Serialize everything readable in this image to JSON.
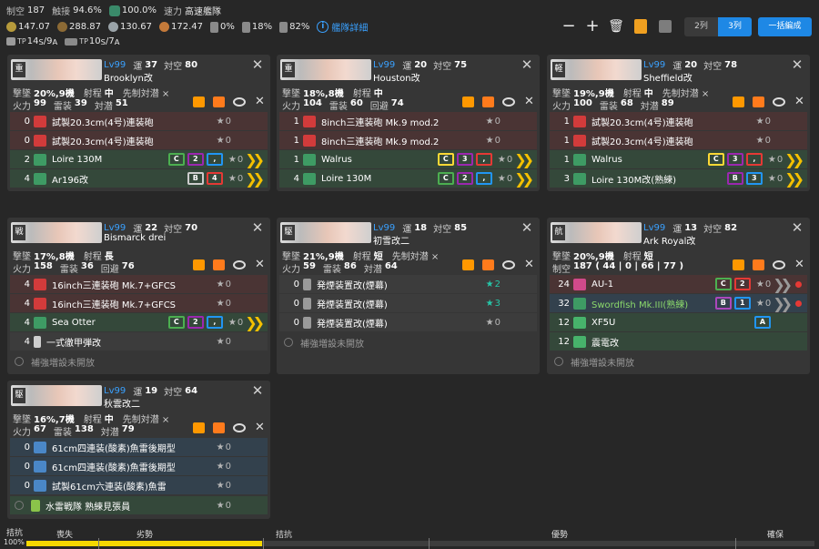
{
  "header": {
    "air_label": "制空",
    "air": "187",
    "contact_label": "触接",
    "contact": "94.6%",
    "speed_pct": "100.0%",
    "speed_label": "速力",
    "speed": "高速艦隊",
    "fuel": "147.07",
    "ammo": "288.87",
    "steel": "130.67",
    "baux": "172.47",
    "ration": "0%",
    "r1": "18%",
    "r2": "82%",
    "detail": "艦隊詳細",
    "tp_s_val": "14",
    "tp_s_sub": "S",
    "tp_a_val": "9",
    "tp_a_sub": "A",
    "tp2_s_val": "10",
    "tp2_s_sub": "S",
    "tp2_a_val": "7",
    "tp2_a_sub": "A",
    "col2": "2列",
    "col3": "3列",
    "bulk": "一括編成"
  },
  "labels": {
    "lv": "Lv99",
    "luck": "運",
    "aa": "対空",
    "fp": "火力",
    "torp": "雷装",
    "eva": "回避",
    "asw": "対潜",
    "range": "射程",
    "oasw": "先制対潜 ×",
    "ex": "補強増設未開放",
    "airpow": "制空"
  },
  "ships": [
    {
      "type": "重",
      "luck": "37",
      "aa": "80",
      "name": "Brooklyn改",
      "shot": "20%,9機",
      "range": "中",
      "oasw": "先制対潜 ×",
      "stats": [
        [
          "火力",
          "99"
        ],
        [
          "雷装",
          "39"
        ],
        [
          "対潜",
          "51"
        ]
      ],
      "slots": [
        [
          "0",
          "gun",
          "試製20.3cm(4号)連装砲",
          "0",
          "",
          ""
        ],
        [
          "0",
          "gun",
          "試製20.3cm(4号)連装砲",
          "0",
          "",
          ""
        ],
        [
          "2",
          "sea",
          "Loire 130M",
          "0",
          "C2,B3,A1",
          "y"
        ],
        [
          "4",
          "sea",
          "Ar196改",
          "0",
          "B4,A2",
          "y"
        ]
      ]
    },
    {
      "type": "重",
      "luck": "20",
      "aa": "75",
      "name": "Houston改",
      "shot": "18%,8機",
      "range": "中",
      "oasw": "",
      "stats": [
        [
          "火力",
          "104"
        ],
        [
          "雷装",
          "60"
        ],
        [
          "回避",
          "74"
        ]
      ],
      "slots": [
        [
          "1",
          "gun",
          "8inch三連装砲 Mk.9 mod.2",
          "0",
          "",
          ""
        ],
        [
          "1",
          "gun",
          "8inch三連装砲 Mk.9 mod.2",
          "0",
          "",
          ""
        ],
        [
          "1",
          "sea",
          "Walrus",
          "0",
          "C3,B2,A2",
          "y"
        ],
        [
          "4",
          "sea",
          "Loire 130M",
          "0",
          "C2,B3,A1",
          "y"
        ]
      ]
    },
    {
      "type": "軽",
      "luck": "20",
      "aa": "78",
      "name": "Sheffield改",
      "shot": "19%,9機",
      "range": "中",
      "oasw": "先制対潜 ×",
      "stats": [
        [
          "火力",
          "100"
        ],
        [
          "雷装",
          "68"
        ],
        [
          "対潜",
          "89"
        ]
      ],
      "slots": [
        [
          "1",
          "gun",
          "試製20.3cm(4号)連装砲",
          "0",
          "",
          ""
        ],
        [
          "1",
          "gun",
          "試製20.3cm(4号)連装砲",
          "0",
          "",
          ""
        ],
        [
          "1",
          "sea",
          "Walrus",
          "0",
          "C3,B2,A2",
          "y"
        ],
        [
          "3",
          "sea",
          "Loire 130M改(熟練)",
          "0",
          "B3,A1",
          "y"
        ]
      ]
    },
    {
      "type": "戦",
      "luck": "22",
      "aa": "70",
      "name": "Bismarck drei",
      "shot": "17%,8機",
      "range": "長",
      "oasw": "",
      "stats": [
        [
          "火力",
          "158"
        ],
        [
          "雷装",
          "36"
        ],
        [
          "回避",
          "76"
        ]
      ],
      "slots": [
        [
          "4",
          "gun",
          "16inch三連装砲 Mk.7+GFCS",
          "0",
          "",
          ""
        ],
        [
          "4",
          "gun",
          "16inch三連装砲 Mk.7+GFCS",
          "0",
          "",
          ""
        ],
        [
          "4",
          "sea",
          "Sea Otter",
          "0",
          "C2,B2,A1",
          "y"
        ],
        [
          "4",
          "shell",
          "一式徹甲弾改",
          "0",
          "",
          ""
        ]
      ]
    },
    {
      "type": "駆",
      "luck": "18",
      "aa": "85",
      "name": "初雪改二",
      "shot": "21%,9機",
      "range": "短",
      "oasw": "先制対潜 ×",
      "stats": [
        [
          "火力",
          "59"
        ],
        [
          "雷装",
          "86"
        ],
        [
          "対潜",
          "64"
        ]
      ],
      "slots": [
        [
          "0",
          "smoke",
          "発煙装置改(煙幕)",
          "2",
          "",
          "c"
        ],
        [
          "0",
          "smoke",
          "発煙装置改(煙幕)",
          "3",
          "",
          "c"
        ],
        [
          "0",
          "smoke",
          "発煙装置改(煙幕)",
          "0",
          "",
          ""
        ]
      ]
    },
    {
      "type": "航",
      "luck": "13",
      "aa": "82",
      "name": "Ark Royal改",
      "shot": "20%,9機",
      "range": "短",
      "oasw": "",
      "stats": [
        [
          "制空",
          "187 ( 44 | 0 | 66 | 77 )"
        ]
      ],
      "slots": [
        [
          "24",
          "aa",
          "AU-1",
          "0",
          "C2,A2",
          "gr"
        ],
        [
          "32",
          "tb",
          "Swordfish Mk.III(熟練)",
          "0",
          "B1,A1",
          "gr"
        ],
        [
          "12",
          "fighter",
          "XF5U",
          "",
          "A3",
          ""
        ],
        [
          "12",
          "fighter",
          "震電改",
          "",
          "",
          ""
        ]
      ]
    },
    {
      "type": "駆",
      "luck": "19",
      "aa": "64",
      "name": "秋雲改二",
      "shot": "16%,7機",
      "range": "中",
      "oasw": "先制対潜 ×",
      "stats": [
        [
          "火力",
          "67"
        ],
        [
          "雷装",
          "138"
        ],
        [
          "対潜",
          "79"
        ]
      ],
      "slots": [
        [
          "0",
          "torp",
          "61cm四連装(酸素)魚雷後期型",
          "0",
          "",
          ""
        ],
        [
          "0",
          "torp",
          "61cm四連装(酸素)魚雷後期型",
          "0",
          "",
          ""
        ],
        [
          "0",
          "torp",
          "試製61cm六連装(酸素)魚雷",
          "0",
          "",
          ""
        ]
      ],
      "ex_item": "水雷戦隊 熟練見張員"
    }
  ],
  "air_bar": {
    "state": "拮抗",
    "pct": "100%",
    "ticks": [
      "喪失",
      "劣勢",
      "拮抗",
      "優勢",
      "確保"
    ]
  }
}
